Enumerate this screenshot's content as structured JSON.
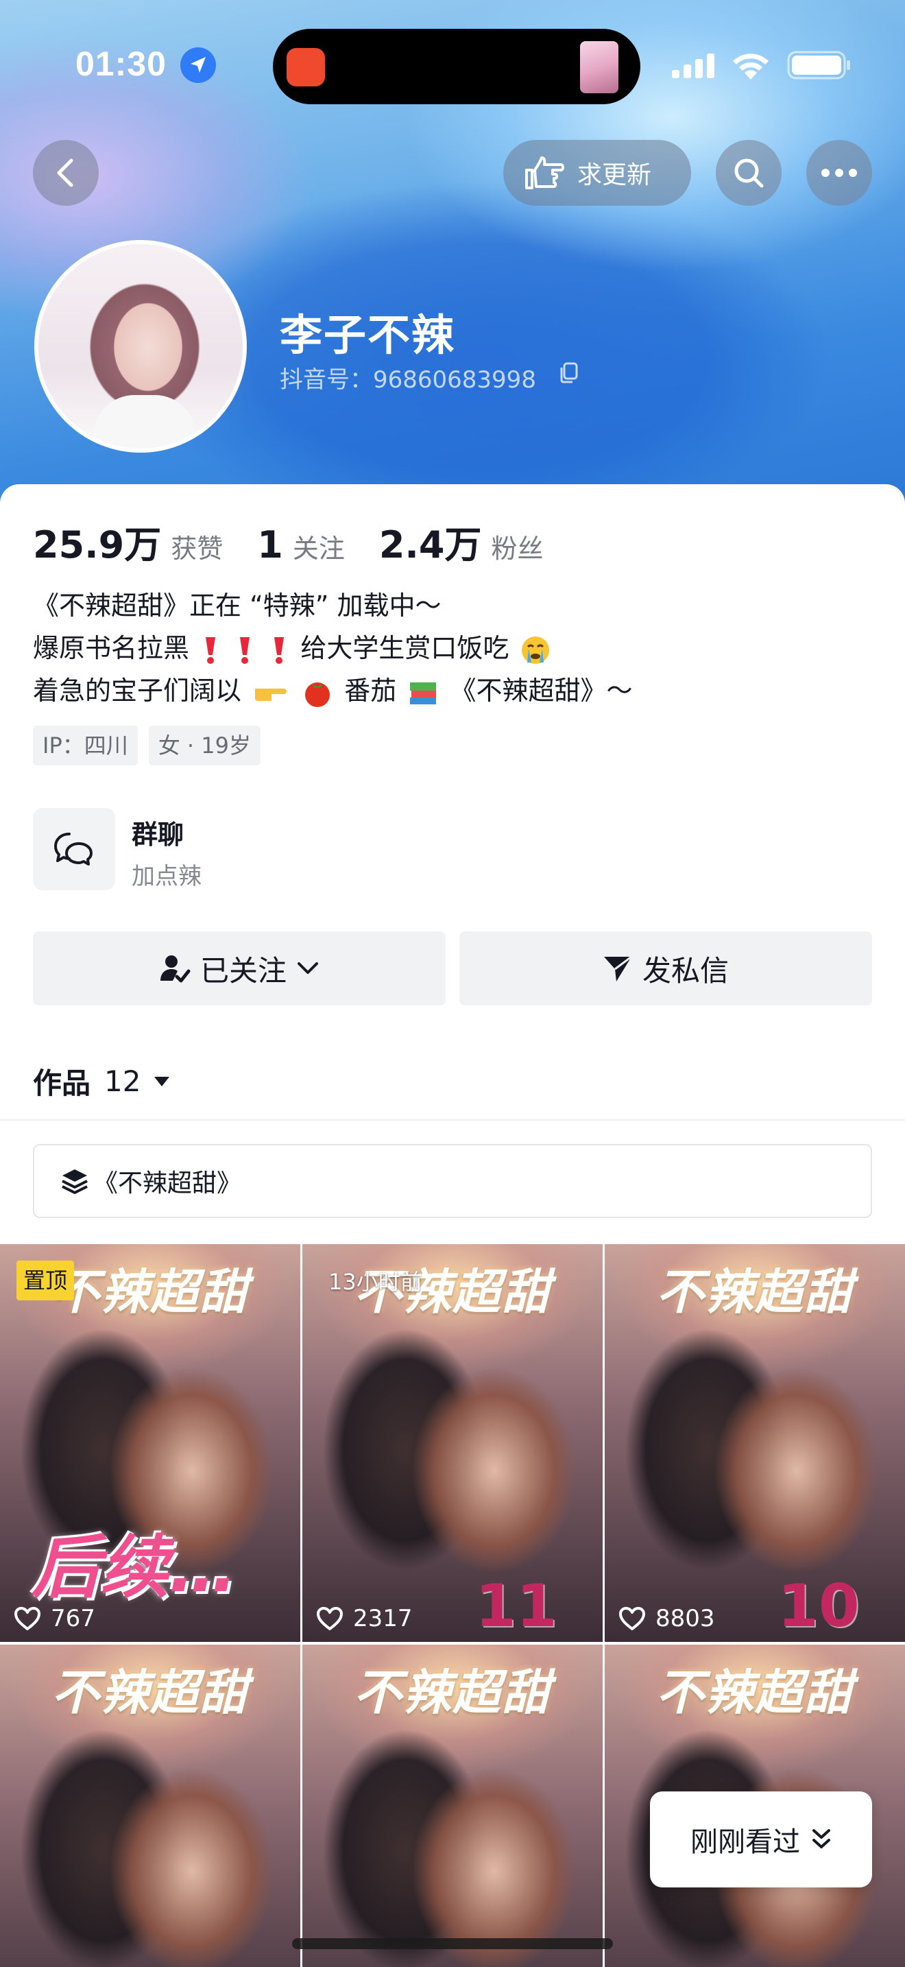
{
  "status_bar": {
    "time": "01:30"
  },
  "header": {
    "request_update_label": "求更新"
  },
  "profile": {
    "name": "李子不辣",
    "douyin_id": "抖音号：96860683998"
  },
  "stats": [
    {
      "value": "25.9万",
      "label": "获赞"
    },
    {
      "value": "1",
      "label": "关注"
    },
    {
      "value": "2.4万",
      "label": "粉丝"
    }
  ],
  "bio": {
    "line1": "《不辣超甜》正在 “特辣” 加载中～",
    "line2_a": "爆原书名拉黑",
    "line2_b": "给大学生赏口饭吃",
    "line3_a": "着急的宝子们阔以",
    "line3_b": "番茄",
    "line3_c": "《不辣超甜》～"
  },
  "tags": [
    "IP：四川",
    "女 · 19岁"
  ],
  "group_chat": {
    "title": "群聊",
    "subtitle": "加点辣"
  },
  "actions": {
    "following_label": "已关注",
    "message_label": "发私信"
  },
  "works": {
    "label": "作品",
    "count": "12"
  },
  "collection": {
    "label": "《不辣超甜》"
  },
  "videos": [
    {
      "title": "不辣超甜",
      "likes": "767",
      "badge": "置顶",
      "overlay": "后续…"
    },
    {
      "title": "不辣超甜",
      "likes": "2317",
      "time_label": "13小时前",
      "episode": "11"
    },
    {
      "title": "不辣超甜",
      "likes": "8803",
      "episode": "10"
    },
    {
      "title": "不辣超甜"
    },
    {
      "title": "不辣超甜"
    },
    {
      "title": "不辣超甜"
    }
  ],
  "recent_button": {
    "label": "刚刚看过"
  },
  "icons": [
    "location-arrow-icon",
    "signal-icon",
    "wifi-icon",
    "battery-icon",
    "back-arrow-icon",
    "pointing-hand-icon",
    "search-icon",
    "more-dots-icon",
    "copy-icon",
    "heart-icon",
    "chat-bubbles-icon",
    "person-check-icon",
    "chevron-down-icon",
    "paper-plane-icon",
    "caret-down-icon",
    "layers-icon",
    "double-chevron-down-icon"
  ],
  "colors": {
    "accent_pink": "#ef4f8f",
    "pin_badge": "#f8d330",
    "hero_blue": "#3b8ae0"
  }
}
